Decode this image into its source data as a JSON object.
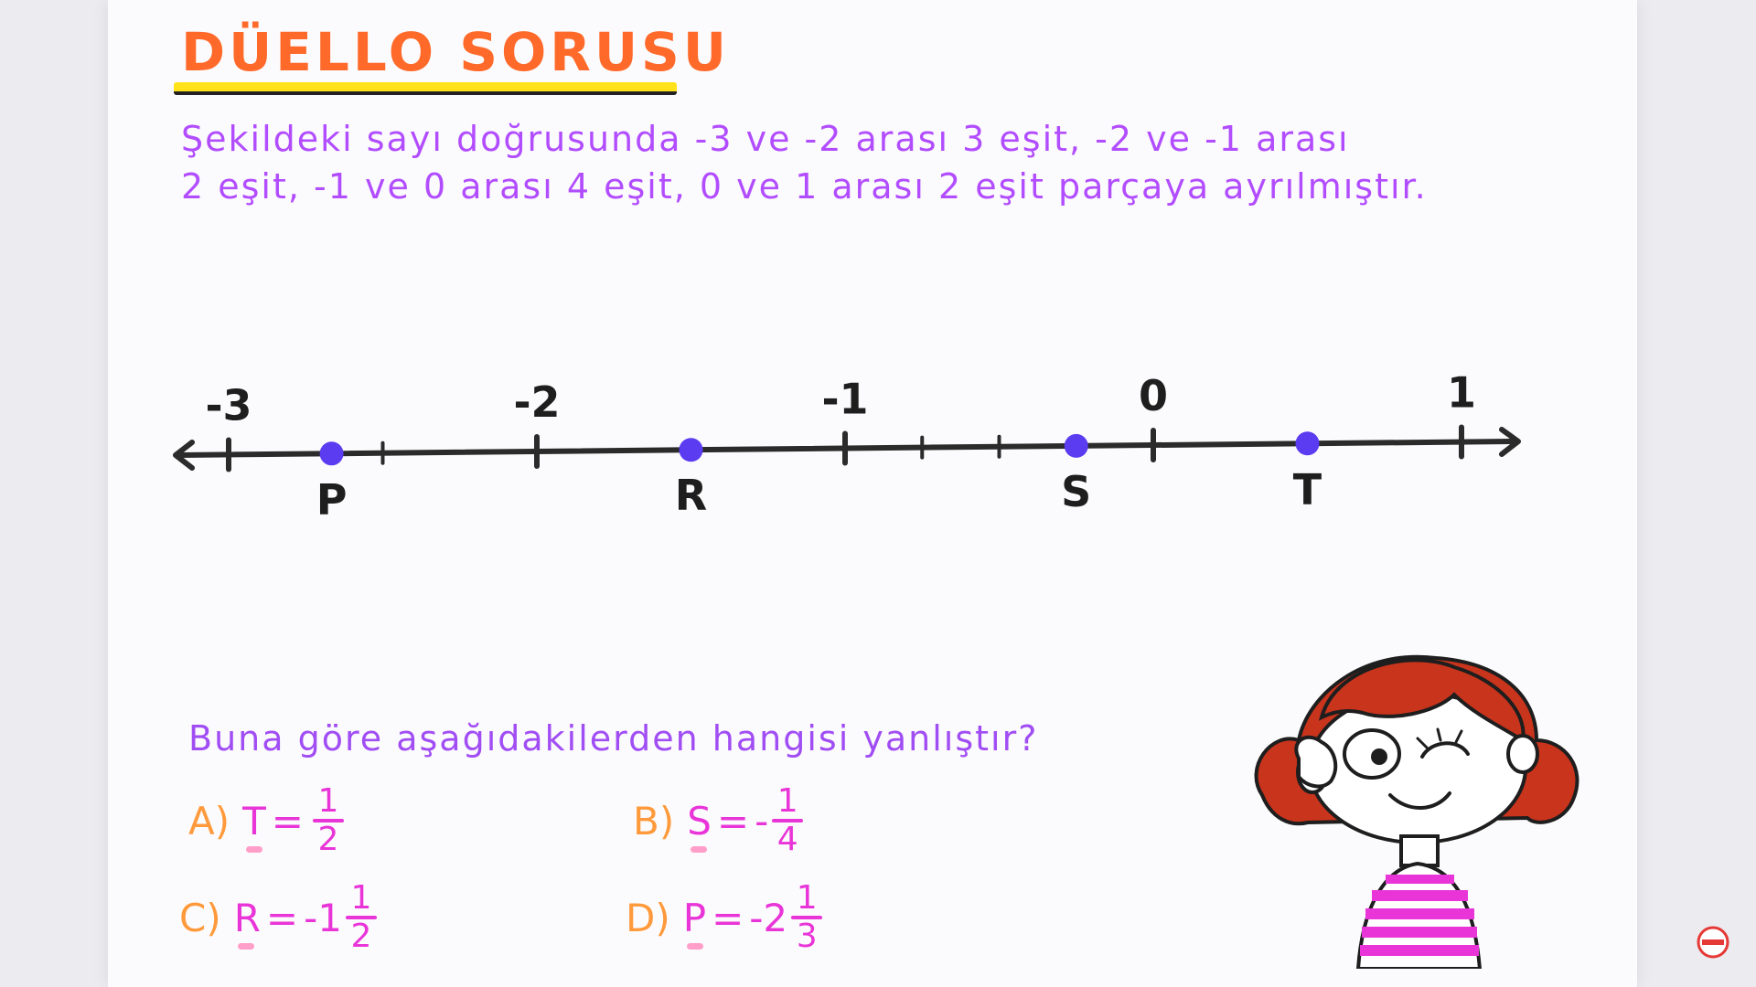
{
  "header": {
    "title": "DÜELLO SORUSU"
  },
  "description": {
    "line1": "Şekildeki sayı doğrusunda -3 ve -2 arası 3 eşit, -2 ve -1 arası",
    "line2": "2 eşit, -1 ve 0 arası 4 eşit, 0 ve 1 arası 2 eşit parçaya ayrılmıştır."
  },
  "number_line": {
    "integers": [
      {
        "label": "-3",
        "value": -3
      },
      {
        "label": "-2",
        "value": -2
      },
      {
        "label": "-1",
        "value": -1
      },
      {
        "label": "0",
        "value": 0
      },
      {
        "label": "1",
        "value": 1
      }
    ],
    "subdivision_ticks": [
      -2.5,
      -0.75,
      -0.5
    ],
    "points": [
      {
        "label": "P",
        "value": -2.666
      },
      {
        "label": "R",
        "value": -1.5
      },
      {
        "label": "S",
        "value": -0.25
      },
      {
        "label": "T",
        "value": 0.5
      }
    ],
    "colors": {
      "line": "#2b2b2b",
      "point": "#5b3cf0"
    }
  },
  "question": {
    "text": "Buna göre aşağıdakilerden hangisi yanlıştır?"
  },
  "options": [
    {
      "letter": "A)",
      "variable": "T",
      "whole": "",
      "numerator": "1",
      "denominator": "2"
    },
    {
      "letter": "B)",
      "variable": "S",
      "whole": "-",
      "numerator": "1",
      "denominator": "4"
    },
    {
      "letter": "C)",
      "variable": "R",
      "whole": "-1",
      "numerator": "1",
      "denominator": "2"
    },
    {
      "letter": "D)",
      "variable": "P",
      "whole": "-2",
      "numerator": "1",
      "denominator": "3"
    }
  ],
  "colors": {
    "title": "#ff6a2a",
    "title_highlight": "#ffe21a",
    "description": "#b24dff",
    "option_letter": "#ff9a3c",
    "option_value": "#e935d8"
  },
  "icons": {
    "illustration": "thinking-girl-icon",
    "channel_logo": "channel-logo-icon"
  }
}
